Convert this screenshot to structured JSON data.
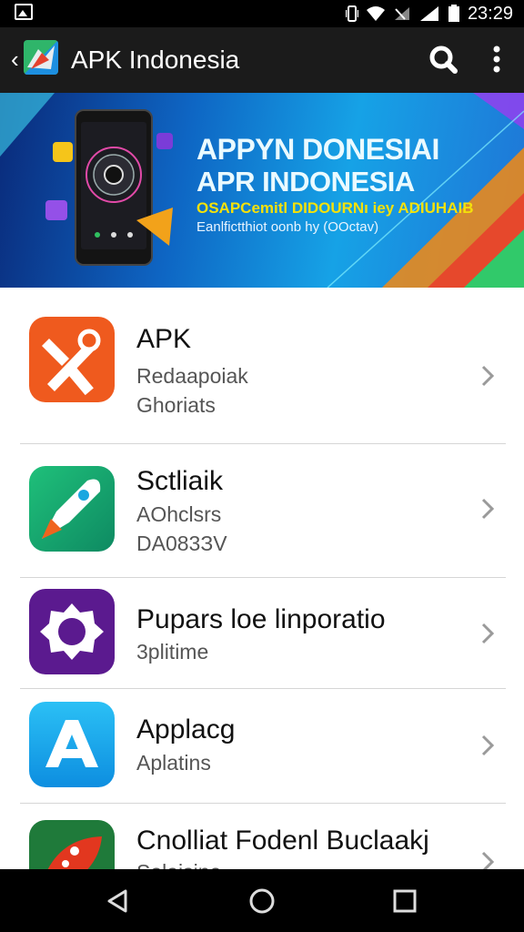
{
  "status_bar": {
    "time": "23:29"
  },
  "app_bar": {
    "title": "APK Indonesia",
    "icons": [
      "back-arrow-icon",
      "app-logo-icon",
      "search-icon",
      "more-vert-icon"
    ]
  },
  "banner": {
    "headline1": "APPYN DONESIAI",
    "headline2": "APR INDONESIA",
    "tagline": "OSAPCemitl DIDOURNı iey ADIUHAIB",
    "subline": "Eanlfictthiоt oonb hy (OOctav)"
  },
  "apps": [
    {
      "title": "APK",
      "line1": "Redaapoiak",
      "line2": "Ghoriats",
      "icon": "tools-icon"
    },
    {
      "title": "Sctliaik",
      "line1": "AOhclsrs",
      "line2": "DA083ЗV",
      "icon": "rocket-icon"
    },
    {
      "title": "Pupars loe linporatio",
      "line1": "3plitime",
      "line2": "",
      "icon": "gear-icon"
    },
    {
      "title": "Applacg",
      "line1": "Aplatins",
      "line2": "",
      "icon": "a-logo-icon"
    },
    {
      "title": "Cnolliat Fodenl Buclaakj",
      "line1": "Solaisine",
      "line2": "",
      "icon": "palette-icon"
    }
  ],
  "colors": {
    "status_bar": "#000000",
    "app_bar": "#1b1b1b",
    "accent_orange": "#ef5a1e",
    "accent_green": "#17a673",
    "accent_purple": "#5b1a8f",
    "accent_blue": "#15a6ea"
  },
  "nav": {
    "icons": [
      "back-triangle-icon",
      "home-circle-icon",
      "recents-square-icon"
    ]
  }
}
